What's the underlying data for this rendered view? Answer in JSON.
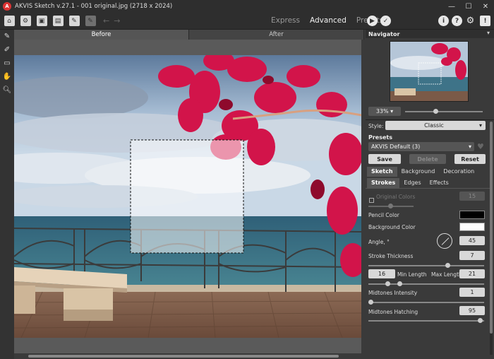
{
  "window": {
    "title": "AKVIS Sketch v.27.1 - 001 original.jpg (2718 x 2024)",
    "controls": [
      "—",
      "☐",
      "✕"
    ]
  },
  "toolbar": {
    "modes": [
      "Express",
      "Advanced",
      "Presets"
    ],
    "active_mode": "Advanced"
  },
  "canvas_tabs": [
    "Before",
    "After"
  ],
  "navigator": {
    "title": "Navigator",
    "zoom": "33%"
  },
  "style": {
    "label": "Style:",
    "value": "Classic"
  },
  "presets": {
    "title": "Presets",
    "value": "AKVIS Default (3)",
    "save": "Save",
    "delete": "Delete",
    "reset": "Reset"
  },
  "main_tabs": [
    "Sketch",
    "Background",
    "Decoration"
  ],
  "sub_tabs": [
    "Strokes",
    "Edges",
    "Effects"
  ],
  "params": {
    "original_colors_label": "Original Colors",
    "original_colors_value": "15",
    "pencil_color_label": "Pencil Color",
    "background_color_label": "Background Color",
    "angle_label": "Angle, °",
    "angle_value": "45",
    "stroke_thickness_label": "Stroke Thickness",
    "stroke_thickness_value": "7",
    "min_length_value": "16",
    "min_length_label": "Min Length",
    "max_length_label": "Max Length",
    "max_length_value": "21",
    "midtones_intensity_label": "Midtones Intensity",
    "midtones_intensity_value": "1",
    "midtones_hatching_label": "Midtones Hatching",
    "midtones_hatching_value": "95"
  },
  "colors": {
    "pencil": "#000000",
    "background": "#ffffff"
  }
}
